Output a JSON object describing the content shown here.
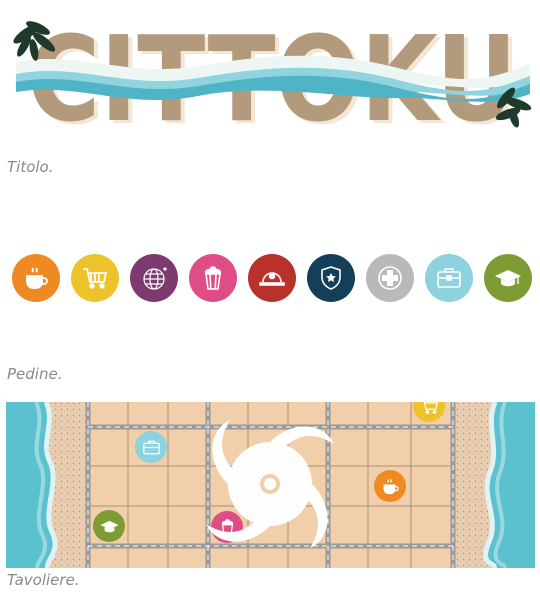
{
  "logo": {
    "text": "CITTOKU"
  },
  "captions": {
    "title": "Titolo.",
    "pawns": "Pedine.",
    "board": "Tavoliere."
  },
  "colors": {
    "title_letters": "#b49a7c",
    "wave_light": "#8fd4df",
    "wave_dark": "#4fb5c6",
    "sea": "#5bc1cf",
    "sand": "#e9cdb0",
    "board_tile": "#f1cfaa",
    "palm": "#1f3a2a"
  },
  "pawns": [
    {
      "name": "coffee-pawn",
      "icon": "coffee-cup-icon",
      "color": "#ef8a22"
    },
    {
      "name": "shopping-pawn",
      "icon": "shopping-cart-icon",
      "color": "#eec22a"
    },
    {
      "name": "disco-pawn",
      "icon": "disco-ball-icon",
      "color": "#7d3a6e"
    },
    {
      "name": "cinema-pawn",
      "icon": "popcorn-icon",
      "color": "#df4d86"
    },
    {
      "name": "firefighter-pawn",
      "icon": "fire-helmet-icon",
      "color": "#b8312b"
    },
    {
      "name": "police-pawn",
      "icon": "police-badge-icon",
      "color": "#153e58"
    },
    {
      "name": "hospital-pawn",
      "icon": "medical-cross-icon",
      "color": "#b9b9b9"
    },
    {
      "name": "office-pawn",
      "icon": "briefcase-icon",
      "color": "#8dd2de"
    },
    {
      "name": "school-pawn",
      "icon": "graduation-cap-icon",
      "color": "#7f9b33"
    }
  ]
}
